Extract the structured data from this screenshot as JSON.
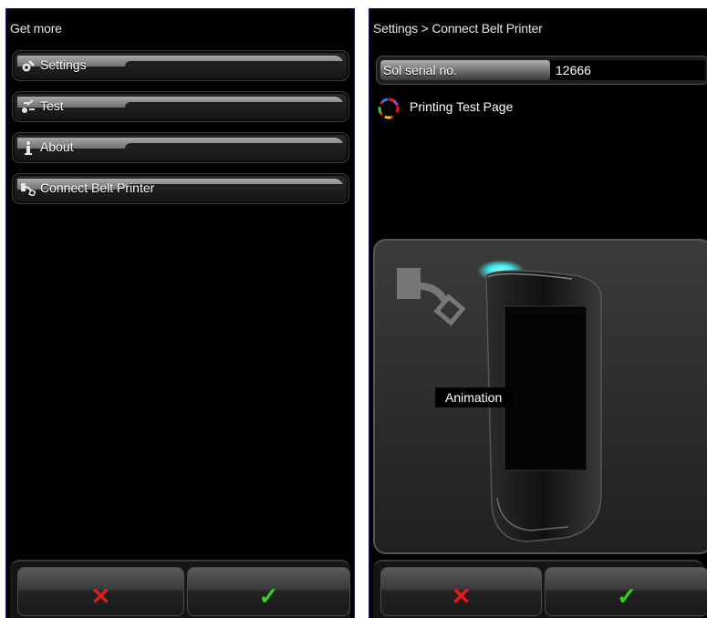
{
  "left_screen": {
    "title": "Get more",
    "menu": [
      {
        "label": "Settings",
        "icon": "settings-icon"
      },
      {
        "label": "Test",
        "icon": "test-icon"
      },
      {
        "label": "About",
        "icon": "info-icon"
      },
      {
        "label": "Connect Belt Printer",
        "icon": "printer-connect-icon"
      }
    ],
    "bottom": {
      "cancel_symbol": "✕",
      "ok_symbol": "✓"
    }
  },
  "right_screen": {
    "title": "Settings > Connect Belt Printer",
    "serial": {
      "label": "Sol serial no.",
      "value": "12666"
    },
    "status_text": "Printing Test Page",
    "animation_label": "Animation",
    "bottom": {
      "cancel_symbol": "✕",
      "ok_symbol": "✓"
    }
  },
  "colors": {
    "cancel": "#e21b1b",
    "ok": "#37d21f",
    "led_glow": "#3fe8f0"
  }
}
